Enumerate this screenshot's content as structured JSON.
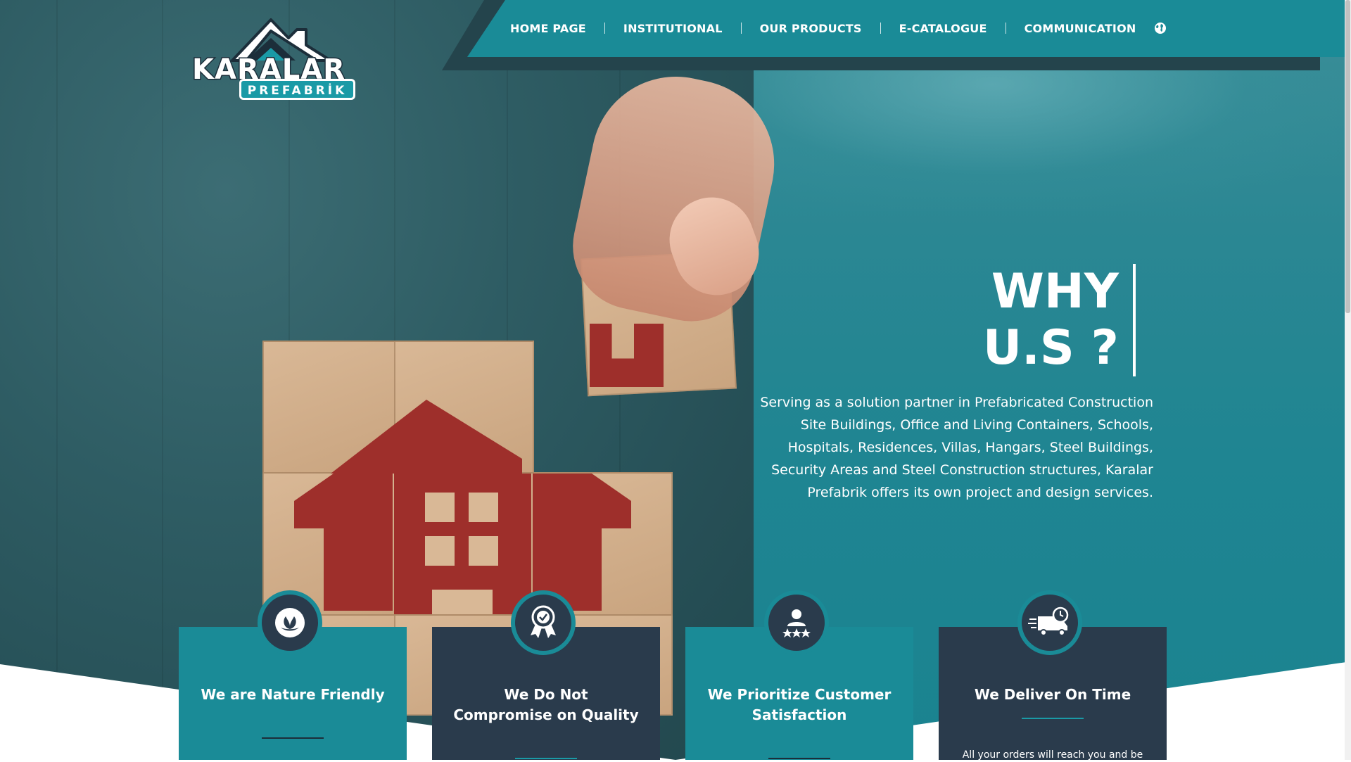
{
  "brand": {
    "name": "KARALAR",
    "subtitle": "PREFABRİK"
  },
  "nav": {
    "items": [
      {
        "label": "HOME PAGE"
      },
      {
        "label": "INSTITUTIONAL"
      },
      {
        "label": "OUR PRODUCTS"
      },
      {
        "label": "E-CATALOGUE"
      },
      {
        "label": "COMMUNICATION"
      }
    ],
    "language_icon": "globe-icon"
  },
  "why": {
    "title_line1": "WHY",
    "title_line2": "U.S ?",
    "description": "Serving as a solution partner in Prefabricated Construction Site Buildings, Office and Living Containers, Schools, Hospitals, Residences, Villas, Hangars, Steel Buildings, Security Areas and Steel Construction structures, Karalar Prefabrik offers its own project and design services."
  },
  "cards": [
    {
      "title": "We are Nature Friendly",
      "icon": "leaf-icon",
      "style": "teal"
    },
    {
      "title": "We Do Not Compromise on Quality",
      "icon": "award-ribbon-icon",
      "style": "dark"
    },
    {
      "title": "We Prioritize Customer Satisfaction",
      "icon": "customer-rating-icon",
      "style": "teal"
    },
    {
      "title": "We Deliver On Time",
      "icon": "delivery-truck-icon",
      "style": "dark",
      "description": "All your orders will reach you and be"
    }
  ],
  "colors": {
    "teal": "#1a8b97",
    "dark_navy": "#2a3b4c",
    "white": "#ffffff"
  }
}
